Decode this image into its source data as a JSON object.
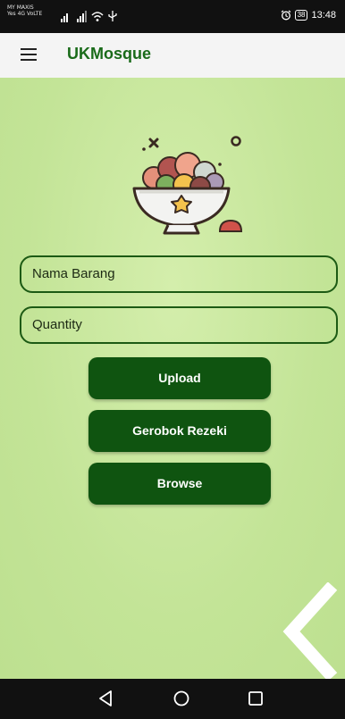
{
  "status_bar": {
    "carrier_line1": "MY MAXIS",
    "carrier_line2": "Yes 4G VoLTE",
    "battery": "38",
    "time": "13:48",
    "alarm_icon": "alarm-icon",
    "wifi_icon": "wifi-icon",
    "signal_icon": "signal-icon",
    "usb_icon": "usb-icon"
  },
  "app_bar": {
    "title": "UKMosque",
    "menu_icon": "hamburger-menu-icon"
  },
  "logo": {
    "icon": "food-bowl-icon"
  },
  "form": {
    "item_name_placeholder": "Nama Barang",
    "quantity_placeholder": "Quantity"
  },
  "buttons": {
    "upload": "Upload",
    "gerobok": "Gerobok Rezeki",
    "browse": "Browse"
  },
  "nav_bar": {
    "back_icon": "back-triangle-icon",
    "home_icon": "home-circle-icon",
    "recent_icon": "recent-apps-square-icon"
  },
  "colors": {
    "background": "#c9e7a0",
    "primary": "#0f5410",
    "title": "#1a6b1a",
    "border": "#1c5a14"
  }
}
